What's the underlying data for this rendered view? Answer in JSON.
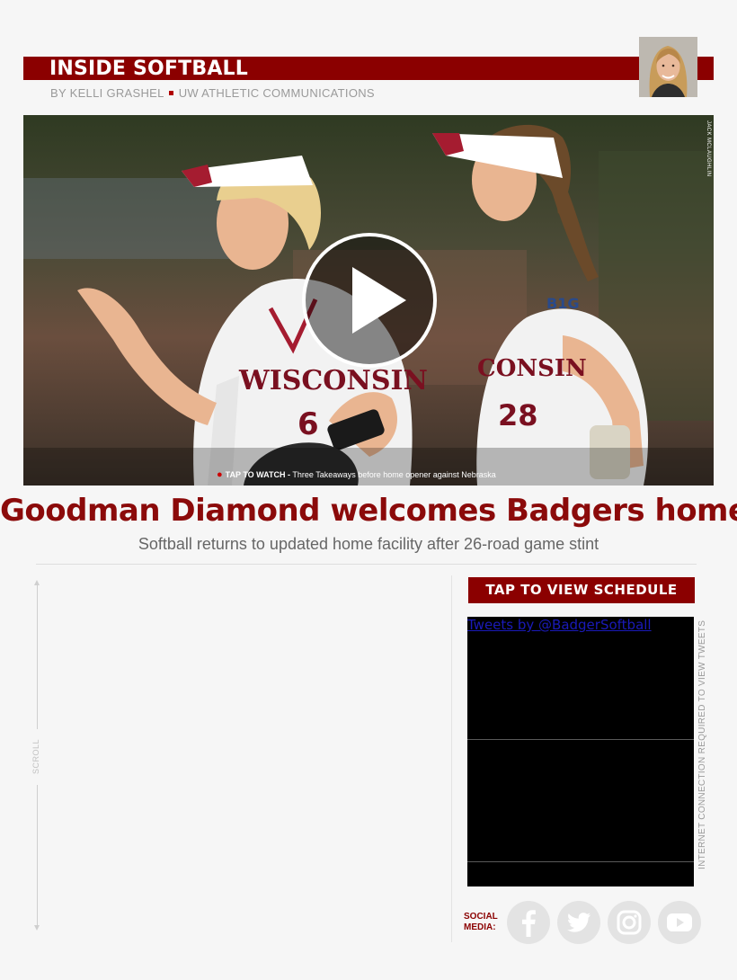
{
  "header": {
    "title": "INSIDE SOFTBALL",
    "author": "BY KELLI GRASHEL",
    "organization": "UW ATHLETIC COMMUNICATIONS",
    "author_photo_icon": "author-portrait"
  },
  "hero": {
    "photo_credit": "JACK MCLAUGHLIN",
    "play_icon": "play-icon",
    "caption_label": "TAP TO WATCH -",
    "caption_text": "Three Takeaways before home opener against Nebraska"
  },
  "article": {
    "headline": "Goodman Diamond welcomes Badgers home",
    "subheadline": "Softball returns to updated home facility after 26-road game stint"
  },
  "sidebar": {
    "scroll_label": "SCROLL",
    "schedule_button": "TAP TO VIEW SCHEDULE",
    "tweets_link": "Tweets by @BadgerSoftball",
    "tweets_note": "INTERNET CONNECTION REQUIRED TO VIEW TWEETS",
    "social_label_line1": "SOCIAL",
    "social_label_line2": "MEDIA:",
    "social_icons": [
      "facebook-icon",
      "twitter-icon",
      "instagram-icon",
      "youtube-icon"
    ]
  },
  "colors": {
    "brand_red": "#8b0000",
    "headline_red": "#8b0a0a",
    "background": "#f6f6f6"
  }
}
